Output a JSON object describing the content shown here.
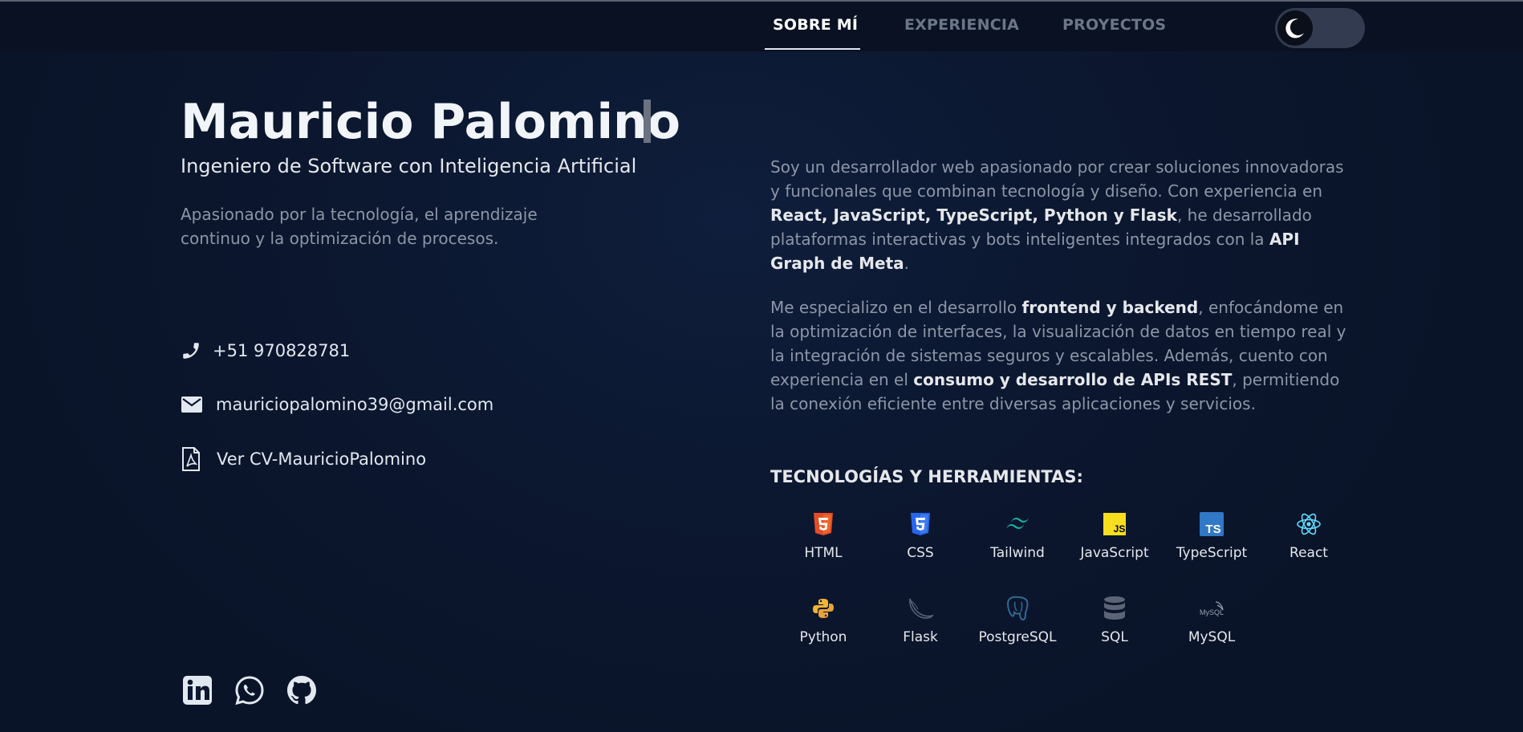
{
  "nav": {
    "tabs": [
      "SOBRE MÍ",
      "EXPERIENCIA",
      "PROYECTOS"
    ],
    "active_tab": "SOBRE MÍ",
    "theme_toggle": "moon-icon"
  },
  "hero": {
    "name": "Mauricio Palomino",
    "subtitle": "Ingeniero de Software con Inteligencia Artificial",
    "tagline": "Apasionado por la tecnología, el aprendizaje continuo y la optimización de procesos."
  },
  "contact": {
    "phone": "+51 970828781",
    "email": "mauriciopalomino39@gmail.com",
    "cv": "Ver CV-MauricioPalomino"
  },
  "about": {
    "p1": [
      {
        "t": "Soy un desarrollador web apasionado por crear soluciones innovadoras y funcionales que combinan tecnología y diseño. Con experiencia en ",
        "b": false
      },
      {
        "t": "React, JavaScript, TypeScript, Python y Flask",
        "b": true
      },
      {
        "t": ", he desarrollado plataformas interactivas y bots inteligentes integrados con la ",
        "b": false
      },
      {
        "t": "API Graph de Meta",
        "b": true
      },
      {
        "t": ".",
        "b": false
      }
    ],
    "p2": [
      {
        "t": "Me especializo en el desarrollo ",
        "b": false
      },
      {
        "t": "frontend y backend",
        "b": true
      },
      {
        "t": ", enfocándome en la optimización de interfaces, la visualización de datos en tiempo real y la integración de sistemas seguros y escalables. Además, cuento con experiencia en el ",
        "b": false
      },
      {
        "t": "consumo y desarrollo de APIs REST",
        "b": true
      },
      {
        "t": ", permitiendo la conexión eficiente entre diversas aplicaciones y servicios.",
        "b": false
      }
    ]
  },
  "tech": {
    "title": "TECNOLOGÍAS Y HERRAMIENTAS:",
    "items": [
      {
        "label": "HTML",
        "icon": "html5-icon"
      },
      {
        "label": "CSS",
        "icon": "css3-icon"
      },
      {
        "label": "Tailwind",
        "icon": "tailwind-icon"
      },
      {
        "label": "JavaScript",
        "icon": "javascript-icon"
      },
      {
        "label": "TypeScript",
        "icon": "typescript-icon"
      },
      {
        "label": "React",
        "icon": "react-icon"
      },
      {
        "label": "Python",
        "icon": "python-icon"
      },
      {
        "label": "Flask",
        "icon": "flask-icon"
      },
      {
        "label": "PostgreSQL",
        "icon": "postgresql-icon"
      },
      {
        "label": "SQL",
        "icon": "database-icon"
      },
      {
        "label": "MySQL",
        "icon": "mysql-icon"
      }
    ],
    "logo_texts": {
      "js": "JS",
      "ts": "TS",
      "mysql": "MySQL"
    }
  },
  "social": [
    "linkedin-icon",
    "whatsapp-icon",
    "github-icon"
  ],
  "colors": {
    "background": "#0c1831",
    "navbar": "#0a1122",
    "text": "#e2e8f0",
    "muted": "#8d96a6",
    "html": "#e44d26",
    "css": "#2965f1",
    "tailwind": "#14b8a6",
    "javascript": "#f7df1e",
    "typescript": "#3178c6",
    "react": "#61dafb"
  }
}
